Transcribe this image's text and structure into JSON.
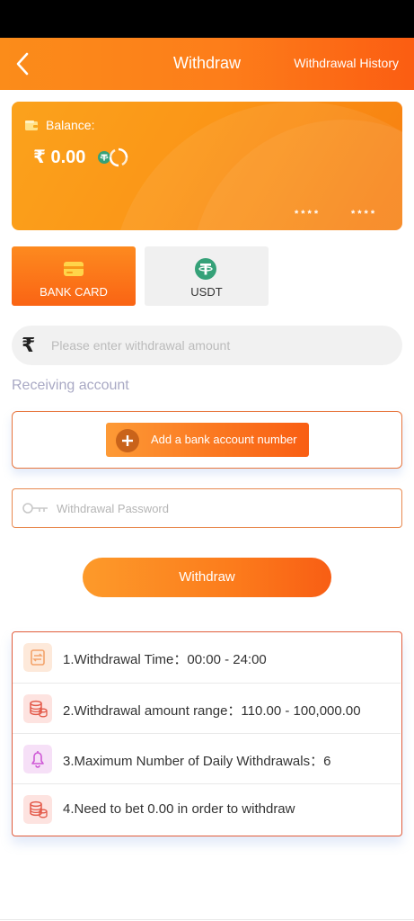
{
  "header": {
    "title": "Withdraw",
    "history_label": "Withdrawal History"
  },
  "balance": {
    "label": "Balance:",
    "amount": "₹ 0.00",
    "masked_left": "****",
    "masked_right": "****"
  },
  "methods": [
    {
      "label": "BANK CARD",
      "icon": "bank-card-icon",
      "selected": true
    },
    {
      "label": "USDT",
      "icon": "usdt-icon",
      "selected": false
    }
  ],
  "amount_input": {
    "symbol": "₹",
    "placeholder": "Please enter withdrawal amount",
    "value": ""
  },
  "receiving": {
    "title": "Receiving account",
    "add_bank_label": "Add a bank account number"
  },
  "password_input": {
    "placeholder": "Withdrawal Password",
    "value": ""
  },
  "withdraw_button": "Withdraw",
  "rules": [
    {
      "text": "1.Withdrawal Time：00:00 - 24:00",
      "icon": "clock-exchange-icon"
    },
    {
      "text": "2.Withdrawal amount range：110.00 - 100,000.00",
      "icon": "coins-icon"
    },
    {
      "text": "3.Maximum Number of Daily Withdrawals：6",
      "icon": "bell-icon"
    },
    {
      "text": "4.Need to bet 0.00 in order to withdraw",
      "icon": "coins-icon"
    }
  ],
  "colors": {
    "accent": "#fb7a1c",
    "accent_dark": "#f95e13",
    "rule_border": "#e25d3c",
    "usdt_green": "#35a178"
  }
}
